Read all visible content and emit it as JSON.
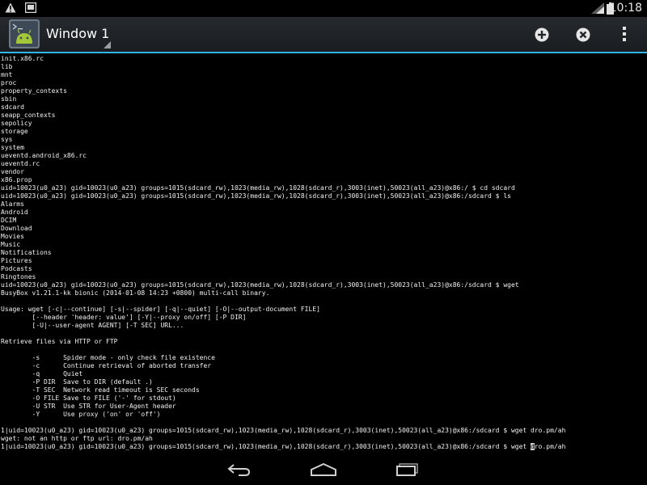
{
  "status_bar": {
    "time": "10:18",
    "icons": [
      "warning-icon",
      "screenshot-icon",
      "wifi-icon",
      "battery-icon"
    ]
  },
  "action_bar": {
    "title": "Window 1",
    "app_icon": "android-terminal-icon",
    "actions": [
      "new-window-icon",
      "close-window-icon",
      "overflow-menu-icon"
    ],
    "accent_color": "#33b5e5"
  },
  "terminal": {
    "lines": [
      "init.x86.rc",
      "lib",
      "mnt",
      "proc",
      "property_contexts",
      "sbin",
      "sdcard",
      "seapp_contexts",
      "sepolicy",
      "storage",
      "sys",
      "system",
      "ueventd.android_x86.rc",
      "ueventd.rc",
      "vendor",
      "x86.prop",
      "uid=10023(u0_a23) gid=10023(u0_a23) groups=1015(sdcard_rw),1023(media_rw),1028(sdcard_r),3003(inet),50023(all_a23)@x86:/ $ cd sdcard",
      "uid=10023(u0_a23) gid=10023(u0_a23) groups=1015(sdcard_rw),1023(media_rw),1028(sdcard_r),3003(inet),50023(all_a23)@x86:/sdcard $ ls",
      "Alarms",
      "Android",
      "DCIM",
      "Download",
      "Movies",
      "Music",
      "Notifications",
      "Pictures",
      "Podcasts",
      "Ringtones",
      "uid=10023(u0_a23) gid=10023(u0_a23) groups=1015(sdcard_rw),1023(media_rw),1028(sdcard_r),3003(inet),50023(all_a23)@x86:/sdcard $ wget",
      "BusyBox v1.21.1-kk bionic (2014-01-08 14:23 +0800) multi-call binary.",
      "",
      "Usage: wget [-c|--continue] [-s|--spider] [-q|--quiet] [-O|--output-document FILE]",
      "        [--header 'header: value'] [-Y|--proxy on/off] [-P DIR]",
      "        [-U|--user-agent AGENT] [-T SEC] URL...",
      "",
      "Retrieve files via HTTP or FTP",
      "",
      "        -s      Spider mode - only check file existence",
      "        -c      Continue retrieval of aborted transfer",
      "        -q      Quiet",
      "        -P DIR  Save to DIR (default .)",
      "        -T SEC  Network read timeout is SEC seconds",
      "        -O FILE Save to FILE ('-' for stdout)",
      "        -U STR  Use STR for User-Agent header",
      "        -Y      Use proxy ('on' or 'off')",
      "",
      "1|uid=10023(u0_a23) gid=10023(u0_a23) groups=1015(sdcard_rw),1023(media_rw),1028(sdcard_r),3003(inet),50023(all_a23)@x86:/sdcard $ wget dro.pm/ah",
      "wget: not an http or ftp url: dro.pm/ah"
    ],
    "prompt_line": {
      "before_cursor": "1|uid=10023(u0_a23) gid=10023(u0_a23) groups=1015(sdcard_rw),1023(media_rw),1028(sdcard_r),3003(inet),50023(all_a23)@x86:/sdcard $ wget ",
      "cursor_char": "d",
      "after_cursor": "ro.pm/ah"
    }
  },
  "nav_bar": {
    "buttons": [
      "back-icon",
      "home-icon",
      "recent-apps-icon"
    ]
  }
}
